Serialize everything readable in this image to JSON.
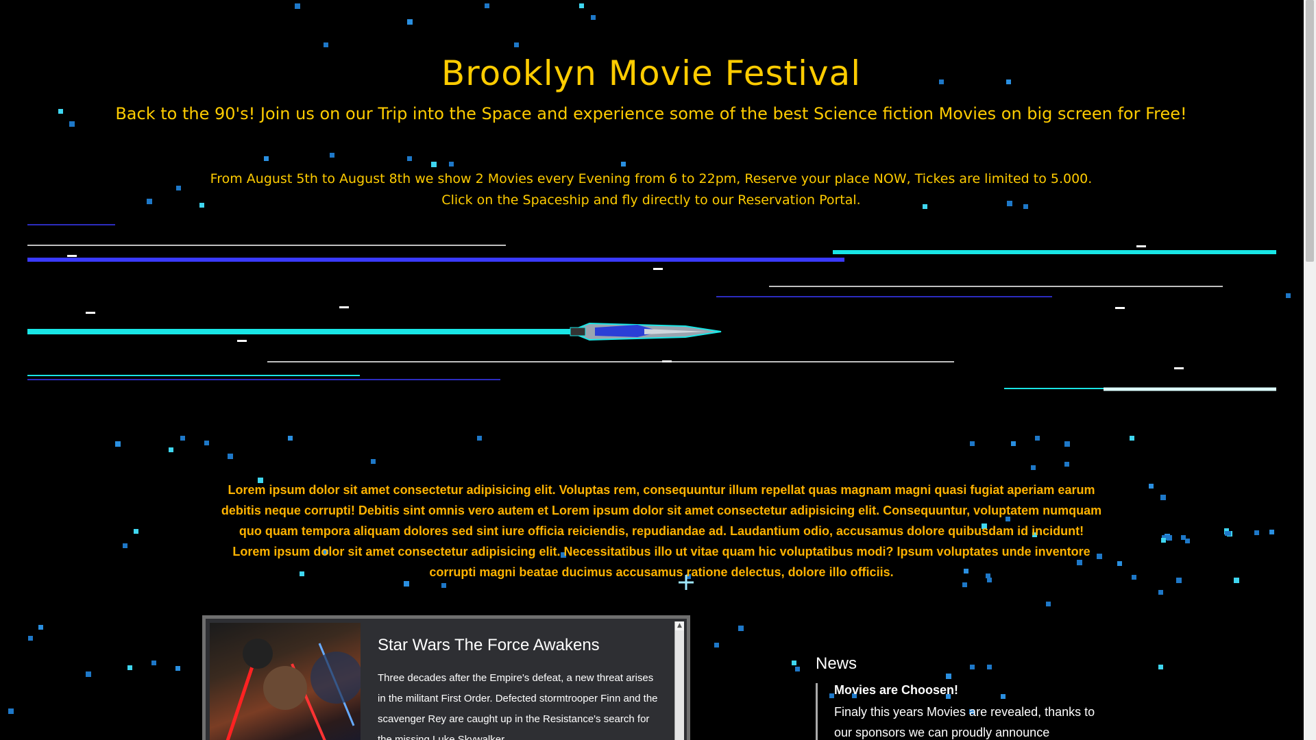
{
  "header": {
    "title": "Brooklyn Movie Festival",
    "subtitle": "Back to the 90's! Join us on our Trip into the Space and experience some of the best Science fiction Movies on big screen for Free!"
  },
  "info": {
    "line1": "From August 5th to August 8th we show 2 Movies every Evening from 6 to 22pm, Reserve your place NOW, Tickes are limited to 5.000.",
    "line2": "Click on the Spaceship and fly directly to our Reservation Portal."
  },
  "intro": {
    "paragraph1": "Lorem ipsum dolor sit amet consectetur adipisicing elit. Voluptas rem, consequuntur illum repellat quas magnam magni quasi fugiat aperiam earum debitis neque corrupti! Debitis sint omnis vero autem et Lorem ipsum dolor sit amet consectetur adipisicing elit. Consequuntur, voluptatem numquam quo quam tempora aliquam dolores sed sint iure officia reiciendis, repudiandae ad. Laudantium odio, accusamus dolore quibusdam id incidunt!",
    "paragraph2": "Lorem ipsum dolor sit amet consectetur adipisicing elit. Necessitatibus illo ut vitae quam hic voluptatibus modi? Ipsum voluptates unde inventore corrupti magni beatae ducimus accusamus ratione delectus, dolore illo officiis."
  },
  "movie": {
    "title": "Star Wars The Force Awakens",
    "description": "Three decades after the Empire's defeat, a new threat arises in the militant First Order. Defected stormtrooper Finn and the scavenger Rey are caught up in the Resistance's search for the missing Luke Skywalker."
  },
  "news": {
    "heading": "News",
    "items": [
      {
        "title": "Movies are Choosen!",
        "body": "Finaly this years Movies are revealed, thanks to our sponsors we can proudly announce"
      }
    ]
  },
  "colors": {
    "background": "#000000",
    "text_accent": "#ffcc00",
    "lorem_text": "#ffb300",
    "star_blue": "#1e78c8",
    "star_cyan": "#3fd6f0",
    "streak_cyan": "#19e6e6",
    "streak_blue": "#3a3aff"
  },
  "icons": {
    "spaceship": "spaceship-icon",
    "scroll_up": "scroll-up-arrow-icon"
  }
}
